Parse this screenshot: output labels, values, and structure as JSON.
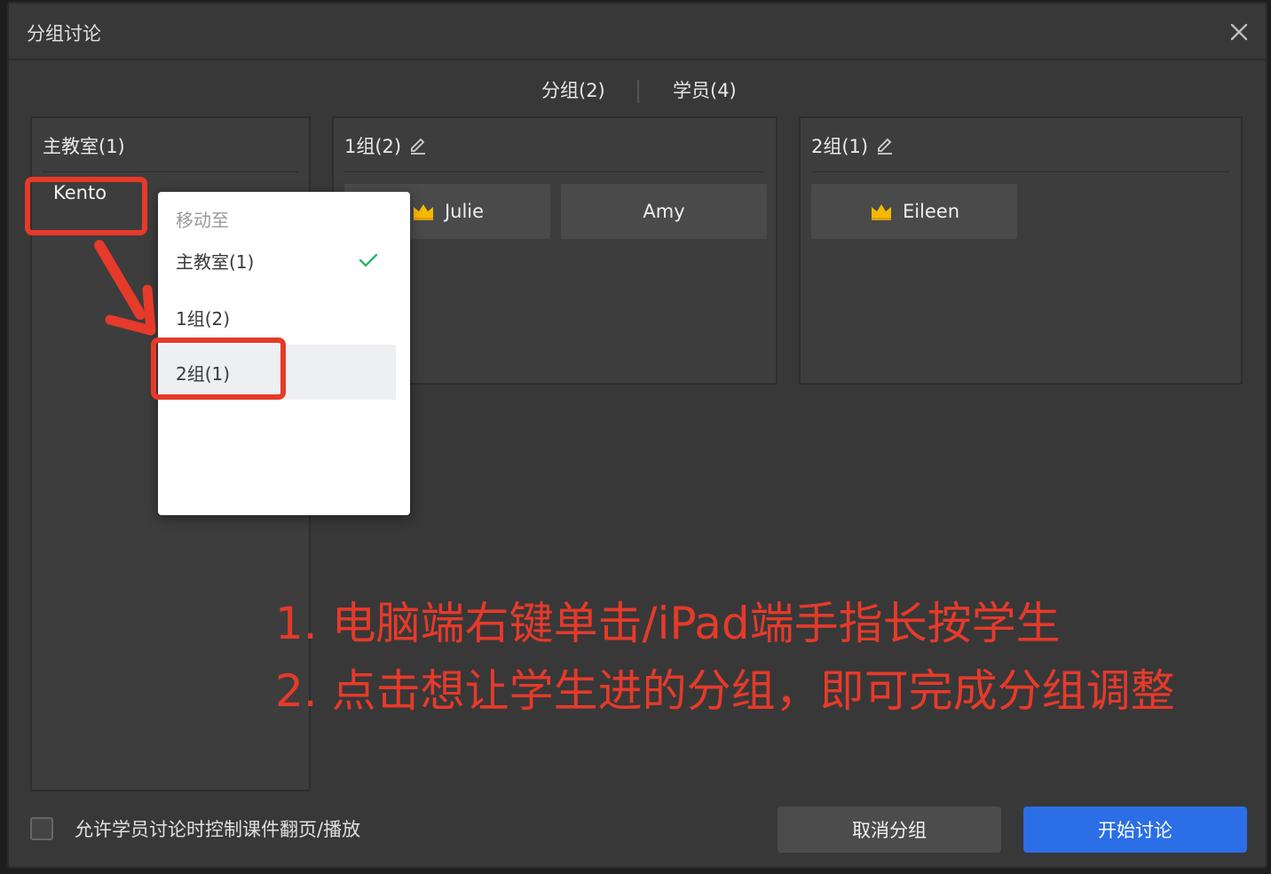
{
  "dialog": {
    "title": "分组讨论"
  },
  "tabs": [
    {
      "label": "分组(2)"
    },
    {
      "label": "学员(4)"
    }
  ],
  "main_room": {
    "title": "主教室(1)",
    "members": [
      "Kento"
    ]
  },
  "groups": [
    {
      "title": "1组(2)",
      "members": [
        {
          "name": "Julie",
          "leader": true
        },
        {
          "name": "Amy",
          "leader": false
        }
      ]
    },
    {
      "title": "2组(1)",
      "members": [
        {
          "name": "Eileen",
          "leader": true
        }
      ]
    }
  ],
  "context_menu": {
    "header": "移动至",
    "items": [
      {
        "label": "主教室(1)",
        "checked": true
      },
      {
        "label": "1组(2)",
        "checked": false
      },
      {
        "label": "2组(1)",
        "checked": false,
        "hovered": true
      }
    ]
  },
  "instructions": [
    "1. 电脑端右键单击/iPad端手指长按学生",
    "2. 点击想让学生进的分组，即可完成分组调整"
  ],
  "footer": {
    "allow_label": "允许学员讨论时控制课件翻页/播放",
    "allow_checked": false,
    "cancel_label": "取消分组",
    "start_label": "开始讨论"
  },
  "colors": {
    "accent": "#2b6ee6",
    "annotation": "#e63a2a",
    "check": "#2bb673",
    "crown": "#f5b800"
  }
}
